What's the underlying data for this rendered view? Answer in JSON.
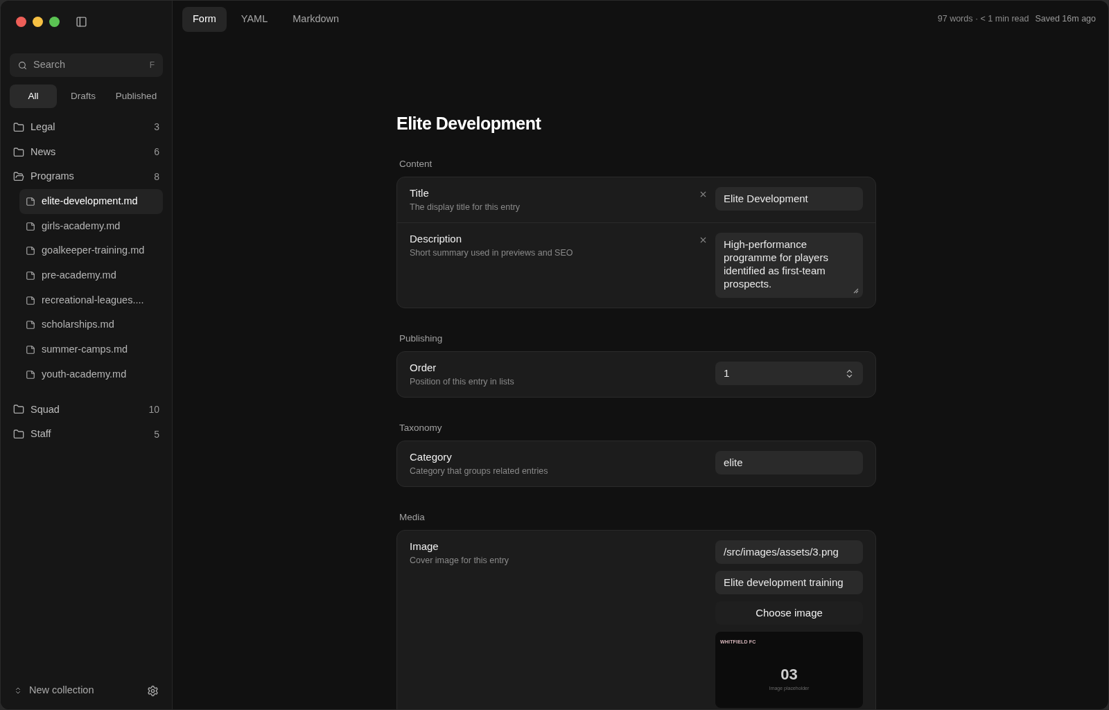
{
  "sidebar": {
    "search": {
      "placeholder": "Search",
      "shortcut": "F"
    },
    "filters": [
      {
        "label": "All",
        "selected": true
      },
      {
        "label": "Drafts",
        "selected": false
      },
      {
        "label": "Published",
        "selected": false
      }
    ],
    "collections": [
      {
        "name": "Legal",
        "count": "3",
        "expanded": false
      },
      {
        "name": "News",
        "count": "6",
        "expanded": false
      },
      {
        "name": "Programs",
        "count": "8",
        "expanded": true,
        "children": [
          {
            "name": "elite-development.md",
            "selected": true
          },
          {
            "name": "girls-academy.md",
            "selected": false
          },
          {
            "name": "goalkeeper-training.md",
            "selected": false
          },
          {
            "name": "pre-academy.md",
            "selected": false
          },
          {
            "name": "recreational-leagues....",
            "selected": false
          },
          {
            "name": "scholarships.md",
            "selected": false
          },
          {
            "name": "summer-camps.md",
            "selected": false
          },
          {
            "name": "youth-academy.md",
            "selected": false
          }
        ]
      },
      {
        "name": "Squad",
        "count": "10",
        "expanded": false
      },
      {
        "name": "Staff",
        "count": "5",
        "expanded": false
      }
    ],
    "footer": {
      "label": "New collection"
    }
  },
  "tabs": [
    {
      "label": "Form",
      "selected": true
    },
    {
      "label": "YAML",
      "selected": false
    },
    {
      "label": "Markdown",
      "selected": false
    }
  ],
  "status": {
    "stats": "97 words · < 1 min read",
    "saved": "Saved 16m ago"
  },
  "page_title": "Elite Development",
  "sections": [
    {
      "heading": "Content",
      "fields": [
        {
          "kind": "text",
          "label": "Title",
          "description": "The display title for this entry",
          "value": "Elite Development",
          "clearable": true
        },
        {
          "kind": "textarea",
          "label": "Description",
          "description": "Short summary used in previews and SEO",
          "value": "High-performance programme for players identified as first-team prospects.",
          "clearable": true
        }
      ]
    },
    {
      "heading": "Publishing",
      "fields": [
        {
          "kind": "number",
          "label": "Order",
          "description": "Position of this entry in lists",
          "value": "1",
          "clearable": false
        }
      ]
    },
    {
      "heading": "Taxonomy",
      "fields": [
        {
          "kind": "text",
          "label": "Category",
          "description": "Category that groups related entries",
          "value": "elite",
          "clearable": false
        }
      ]
    },
    {
      "heading": "Media",
      "fields": [
        {
          "kind": "image",
          "label": "Image",
          "description": "Cover image for this entry",
          "value": "/src/images/assets/3.png",
          "alt": "Elite development training",
          "button": "Choose image",
          "preview": {
            "brand": "WHITFIELD FC",
            "number": "03",
            "caption": "Image placeholder"
          },
          "clearable": false
        }
      ]
    }
  ]
}
